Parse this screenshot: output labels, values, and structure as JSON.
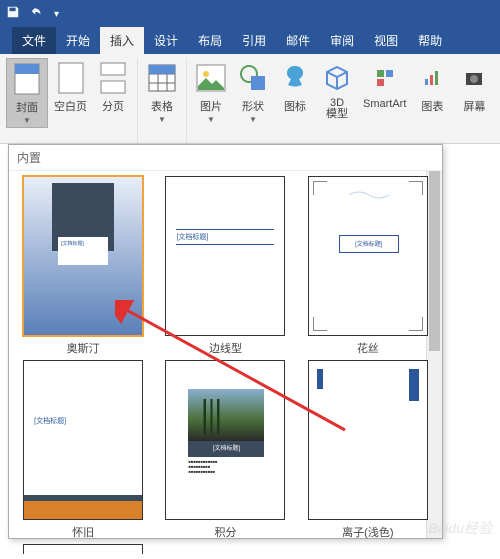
{
  "titlebar": {
    "save": "save",
    "undo": "undo"
  },
  "tabs": {
    "file": "文件",
    "home": "开始",
    "insert": "插入",
    "design": "设计",
    "layout": "布局",
    "references": "引用",
    "mail": "邮件",
    "review": "审阅",
    "view": "视图",
    "help": "帮助"
  },
  "ribbon": {
    "cover": "封面",
    "blank": "空白页",
    "break": "分页",
    "table": "表格",
    "picture": "图片",
    "shapes": "形状",
    "icons": "图标",
    "model3d": "3D\n模型",
    "smartart": "SmartArt",
    "chart": "图表",
    "screenshot": "屏幕"
  },
  "gallery": {
    "header": "内置",
    "items": [
      {
        "name": "奥斯汀",
        "title": "[文档标题]"
      },
      {
        "name": "边线型",
        "title": "[文档标题]"
      },
      {
        "name": "花丝",
        "title": "[文档标题]"
      },
      {
        "name": "怀旧",
        "title": "[文档标题]"
      },
      {
        "name": "积分",
        "title": "[文档标题]"
      },
      {
        "name": "离子(浅色)",
        "title": ""
      }
    ]
  },
  "watermark": "Baidu经验"
}
